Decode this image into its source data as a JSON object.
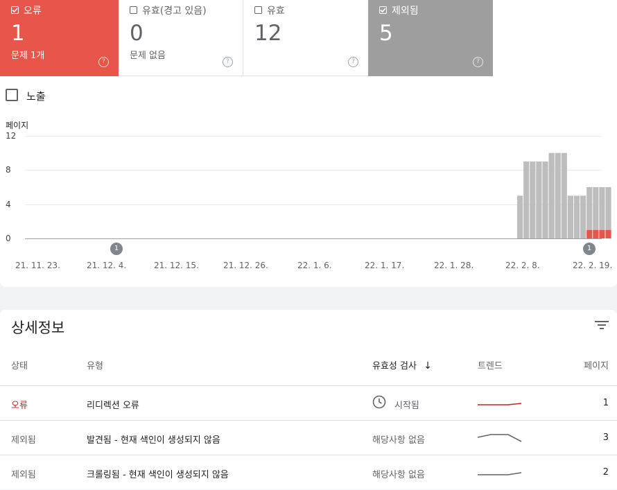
{
  "tiles": [
    {
      "label": "오류",
      "checked": true,
      "count": "1",
      "sub": "문제 1개",
      "color": "#e8554a"
    },
    {
      "label": "유효(경고 있음)",
      "checked": false,
      "count": "0",
      "sub": "문제 없음"
    },
    {
      "label": "유효",
      "checked": false,
      "count": "12",
      "sub": ""
    },
    {
      "label": "제외됨",
      "checked": true,
      "count": "5",
      "sub": "",
      "color": "#9e9e9e"
    }
  ],
  "impressions_label": "노출",
  "chart_data": {
    "type": "bar",
    "ylabel": "페이지",
    "yticks": [
      "12",
      "8",
      "4",
      "0"
    ],
    "ylim": [
      0,
      12
    ],
    "xticks": [
      "21. 11. 23.",
      "21. 12. 4.",
      "21. 12. 15.",
      "21. 12. 26.",
      "22. 1. 6.",
      "22. 1. 17.",
      "22. 1. 28.",
      "22. 2. 8.",
      "22. 2. 19."
    ],
    "annotations": [
      "1",
      "1"
    ],
    "series": [
      {
        "values": [
          0,
          0,
          0,
          0,
          0,
          0,
          0,
          0,
          0,
          0,
          0,
          1,
          1,
          1,
          1
        ],
        "color": "#e8554a"
      },
      {
        "values": [
          5,
          9,
          9,
          9,
          9,
          10,
          10,
          10,
          5,
          5,
          5,
          5,
          5,
          5,
          5
        ],
        "color": "#bdbdbd"
      }
    ]
  },
  "details": {
    "title": "상세정보",
    "headers": {
      "status": "상태",
      "type": "유형",
      "validation": "유효성 검사",
      "trend": "트렌드",
      "pages": "페이지"
    },
    "rows": [
      {
        "status": "오류",
        "type": "리디렉션 오류",
        "validation": "시작됨",
        "pages": "1"
      },
      {
        "status": "제외됨",
        "type": "발견됨 - 현재 색인이 생성되지 않음",
        "validation": "해당사항 없음",
        "pages": "3"
      },
      {
        "status": "제외됨",
        "type": "크롤링됨 - 현재 색인이 생성되지 않음",
        "validation": "해당사항 없음",
        "pages": "2"
      }
    ]
  }
}
